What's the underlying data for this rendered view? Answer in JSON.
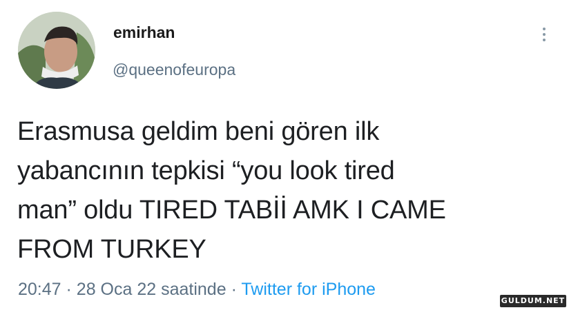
{
  "tweet": {
    "author": {
      "display_name": "emirhan",
      "username": "@queenofeuropa",
      "avatar_icon": "profile-photo"
    },
    "more_icon": "more-options-icon",
    "text_lines": [
      "Erasmusa geldim beni gören ilk",
      "yabancının tepkisi “you look tired",
      "man” oldu TIRED TABİİ AMK I CAME",
      "FROM TURKEY"
    ],
    "meta": {
      "time": "20:47",
      "separator": "·",
      "date": "28 Oca 22 saatinde",
      "source": "Twitter for iPhone"
    }
  },
  "watermark": "GULDUM.NET",
  "colors": {
    "secondary_text": "#5b7083",
    "link": "#1d9bf0",
    "primary_text": "#1d1f22"
  }
}
